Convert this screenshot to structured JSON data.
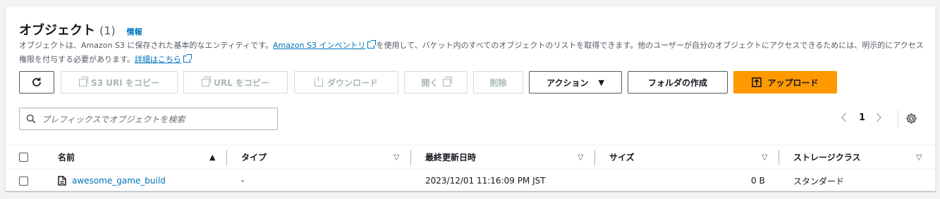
{
  "header": {
    "title": "オブジェクト",
    "count": "(1)",
    "info": "情報"
  },
  "description": {
    "part1": "オブジェクトは、Amazon S3 に保存された基本的なエンティティです。",
    "link1": "Amazon S3 インベントリ",
    "part2": "を使用して、バケット内のすべてのオブジェクトのリストを取得できます。他のユーザーが自分のオブジェクトにアクセスできるためには、明示的にアクセス権限を付与する必要があります。",
    "link2": "詳細はこちら"
  },
  "toolbar": {
    "copy_s3_uri": "S3 URI をコピー",
    "copy_url": "URL をコピー",
    "download": "ダウンロード",
    "open": "開く",
    "delete": "削除",
    "actions": "アクション",
    "create_folder": "フォルダの作成",
    "upload": "アップロード"
  },
  "search": {
    "placeholder": "プレフィックスでオブジェクトを検索"
  },
  "pagination": {
    "current_page": "1"
  },
  "table": {
    "columns": [
      "名前",
      "タイプ",
      "最終更新日時",
      "サイズ",
      "ストレージクラス"
    ],
    "rows": [
      {
        "name": "awesome_game_build",
        "type": "-",
        "last_modified": "2023/12/01 11:16:09 PM JST",
        "size": "0 B",
        "storage_class": "スタンダード"
      }
    ]
  },
  "colors": {
    "link": "#0073bb",
    "primary_button": "#ff9900",
    "disabled_text": "#aab7b8"
  }
}
